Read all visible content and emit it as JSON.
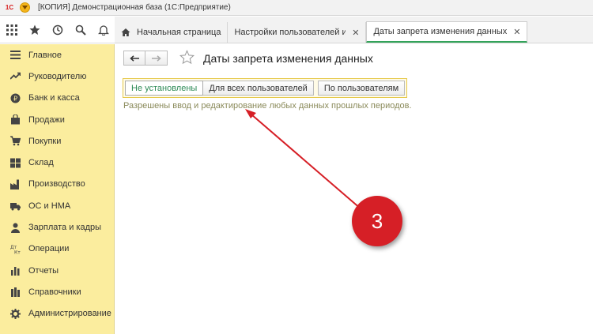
{
  "window": {
    "logo_text": "1С",
    "title": "[КОПИЯ] Демонстрационная база  (1С:Предприятие)"
  },
  "toolbar": {
    "icons": [
      "apps-grid-icon",
      "star-icon",
      "history-icon",
      "search-icon",
      "bell-icon"
    ]
  },
  "tabs": [
    {
      "label": "Начальная страница",
      "active": false,
      "closable": false
    },
    {
      "label": "Настройки пользователей и прав",
      "active": false,
      "closable": true
    },
    {
      "label": "Даты запрета изменения данных",
      "active": true,
      "closable": true
    }
  ],
  "sidebar": {
    "items": [
      {
        "label": "Главное",
        "icon": "menu-lines-icon"
      },
      {
        "label": "Руководителю",
        "icon": "trend-icon"
      },
      {
        "label": "Банк и касса",
        "icon": "coin-icon"
      },
      {
        "label": "Продажи",
        "icon": "bag-icon"
      },
      {
        "label": "Покупки",
        "icon": "cart-icon"
      },
      {
        "label": "Склад",
        "icon": "boxes-icon"
      },
      {
        "label": "Производство",
        "icon": "factory-icon"
      },
      {
        "label": "ОС и НМА",
        "icon": "truck-icon"
      },
      {
        "label": "Зарплата и кадры",
        "icon": "person-icon"
      },
      {
        "label": "Операции",
        "icon": "dt-kt-icon"
      },
      {
        "label": "Отчеты",
        "icon": "bar-chart-icon"
      },
      {
        "label": "Справочники",
        "icon": "books-icon"
      },
      {
        "label": "Администрирование",
        "icon": "gear-icon"
      }
    ]
  },
  "main": {
    "title": "Даты запрета изменения данных",
    "modes": {
      "not_set": "Не установлены",
      "all_users": "Для всех пользователей",
      "by_users": "По пользователям"
    },
    "selected_mode": "Не установлены",
    "info": "Разрешены ввод и редактирование любых данных прошлых периодов."
  },
  "annotation": {
    "badge": "3",
    "color": "#d61f26"
  }
}
